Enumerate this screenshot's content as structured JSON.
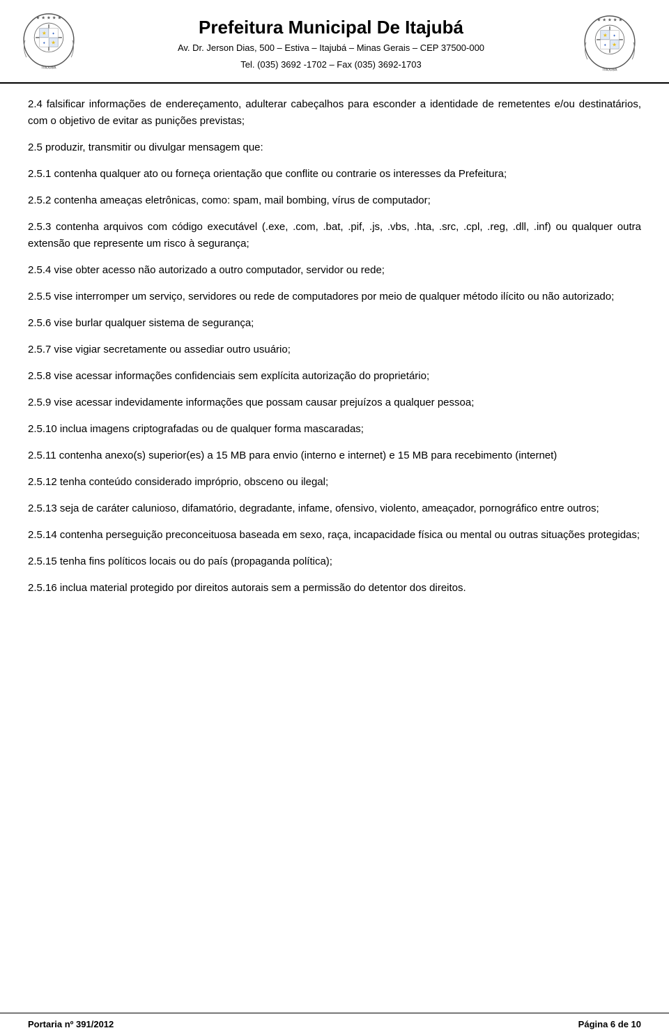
{
  "header": {
    "title": "Prefeitura Municipal De Itajubá",
    "subtitle_line1": "Av. Dr. Jerson Dias, 500 – Estiva – Itajubá – Minas Gerais – CEP 37500-000",
    "subtitle_line2": "Tel. (035) 3692 -1702 – Fax (035) 3692-1703"
  },
  "paragraphs": [
    {
      "id": "p2_4",
      "text": "2.4 falsificar informações de endereçamento, adulterar cabeçalhos para esconder a identidade de remetentes e/ou destinatários, com o objetivo de evitar as punições previstas;"
    },
    {
      "id": "p2_5",
      "text": "2.5 produzir, transmitir ou divulgar mensagem que:"
    },
    {
      "id": "p2_5_1",
      "text": "2.5.1 contenha qualquer ato ou forneça orientação que conflite ou contrarie os interesses da Prefeitura;"
    },
    {
      "id": "p2_5_2",
      "text": "2.5.2 contenha ameaças eletrônicas, como: spam, mail bombing, vírus de computador;"
    },
    {
      "id": "p2_5_3",
      "text": "2.5.3 contenha arquivos com código executável (.exe, .com, .bat, .pif, .js, .vbs, .hta, .src, .cpl, .reg, .dll, .inf) ou qualquer outra extensão que represente um risco à segurança;"
    },
    {
      "id": "p2_5_4",
      "text": "2.5.4 vise obter acesso não autorizado a outro computador, servidor ou rede;"
    },
    {
      "id": "p2_5_5",
      "text": "2.5.5 vise interromper um serviço, servidores ou rede de computadores por meio de qualquer método ilícito ou não autorizado;"
    },
    {
      "id": "p2_5_6",
      "text": "2.5.6 vise burlar qualquer sistema de segurança;"
    },
    {
      "id": "p2_5_7",
      "text": "2.5.7 vise vigiar secretamente ou assediar outro usuário;"
    },
    {
      "id": "p2_5_8",
      "text": "2.5.8 vise acessar informações confidenciais sem explícita autorização do proprietário;"
    },
    {
      "id": "p2_5_9",
      "text": "2.5.9 vise acessar indevidamente informações que possam causar prejuízos a qualquer pessoa;"
    },
    {
      "id": "p2_5_10",
      "text": "2.5.10 inclua imagens criptografadas ou de qualquer forma mascaradas;"
    },
    {
      "id": "p2_5_11",
      "text": "2.5.11 contenha anexo(s) superior(es) a 15 MB para envio (interno e internet) e 15 MB para recebimento (internet)"
    },
    {
      "id": "p2_5_12",
      "text": "2.5.12 tenha conteúdo considerado impróprio, obsceno ou ilegal;"
    },
    {
      "id": "p2_5_13",
      "text": "2.5.13 seja de caráter calunioso, difamatório, degradante, infame, ofensivo, violento, ameaçador, pornográfico entre outros;"
    },
    {
      "id": "p2_5_14",
      "text": "2.5.14 contenha perseguição preconceituosa baseada em sexo, raça, incapacidade física ou mental ou outras situações protegidas;"
    },
    {
      "id": "p2_5_15",
      "text": "2.5.15 tenha fins políticos locais ou do país (propaganda política);"
    },
    {
      "id": "p2_5_16",
      "text": "2.5.16 inclua material protegido por direitos autorais sem a permissão do detentor dos direitos."
    }
  ],
  "footer": {
    "left": "Portaria nº 391/2012",
    "right": "Página 6 de 10"
  }
}
